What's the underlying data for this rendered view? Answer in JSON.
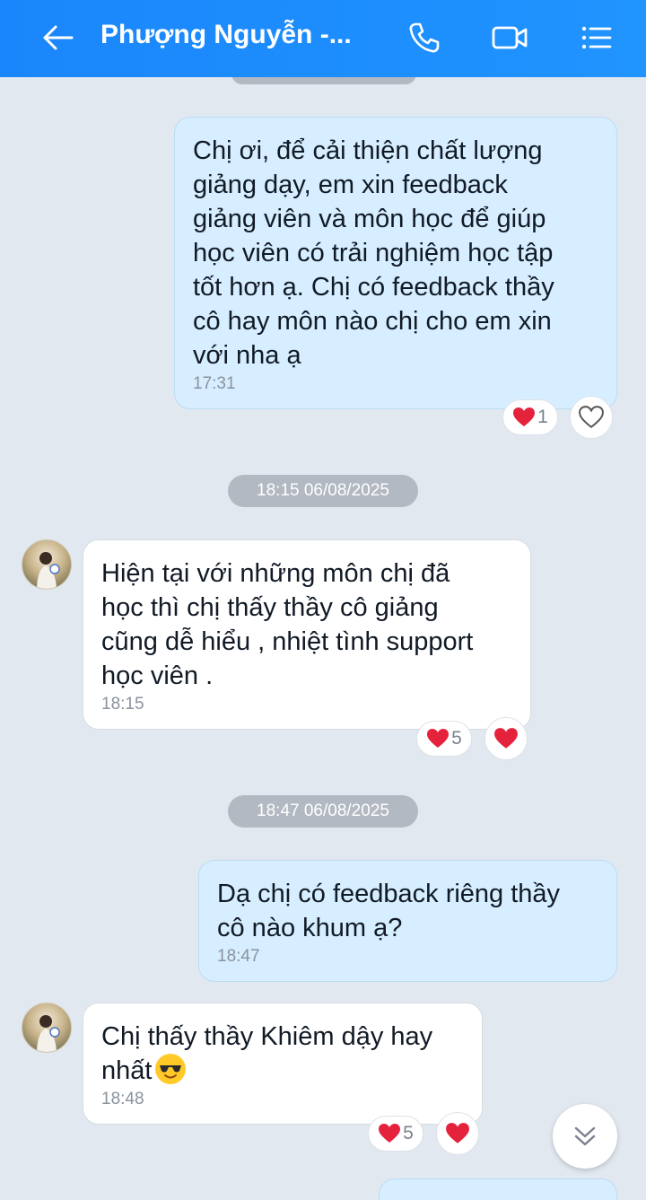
{
  "header": {
    "title": "Phượng Nguyễn -...",
    "back_icon": "arrow-left-icon",
    "call_icon": "phone-icon",
    "video_icon": "video-icon",
    "menu_icon": "list-icon"
  },
  "messages": [
    {
      "sender": "me",
      "text": "Chị ơi, để cải thiện chất lượng\ngiảng dạy, em xin feedback\ngiảng viên và môn học để giúp\nhọc viên có trải nghiệm học tập\ntốt hơn ạ. Chị có feedback thầy\ncô hay môn nào chị cho em xin\nvới nha ạ",
      "time": "17:31",
      "reaction_count": "1"
    },
    {
      "sender": "other",
      "date_separator": "18:15 06/08/2025",
      "text": "Hiện tại với những môn chị đã\nhọc thì chị thấy thầy cô giảng\ncũng dễ hiểu , nhiệt tình support\nhọc viên .",
      "time": "18:15",
      "reaction_count": "5"
    },
    {
      "sender": "me",
      "date_separator": "18:47 06/08/2025",
      "text": "Dạ chị có feedback riêng thầy\ncô nào khum ạ?",
      "time": "18:47"
    },
    {
      "sender": "other",
      "text": "Chị thấy thầy Khiêm dậy hay\nnhất",
      "emoji": "sunglasses-emoji",
      "time": "18:48",
      "reaction_count": "5"
    }
  ],
  "colors": {
    "header": "#1a86fb",
    "background": "#e2e8f0",
    "my_bubble": "#d6eeff",
    "heart": "#e5223b"
  }
}
